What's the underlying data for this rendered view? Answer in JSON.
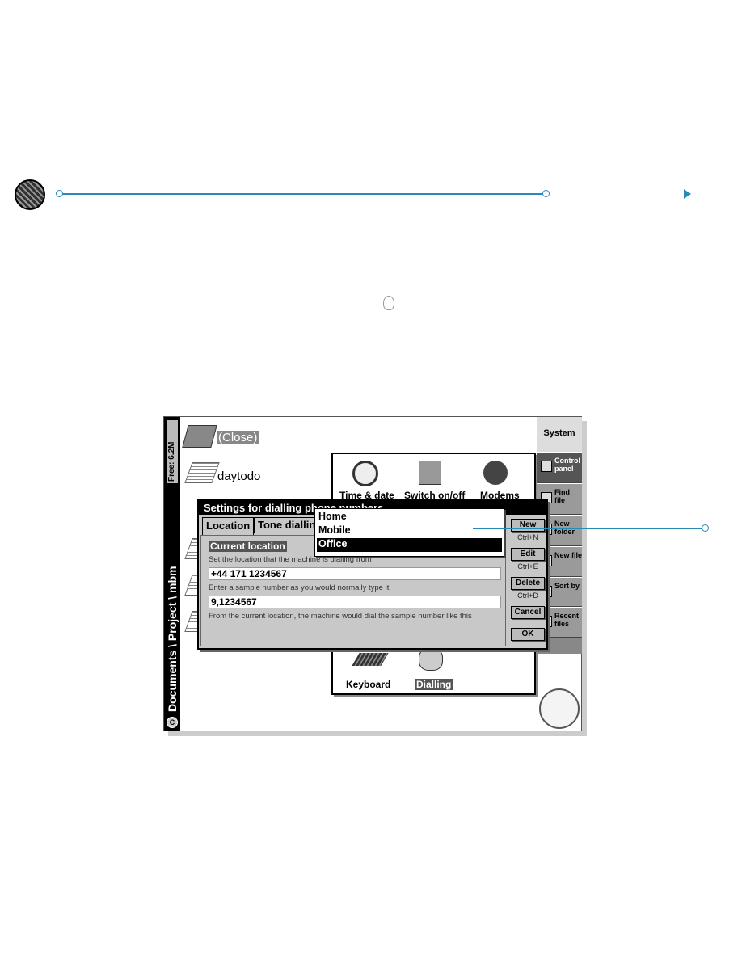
{
  "screen": {
    "free_space": "Free: 6.2M",
    "path": "Documents \\ Project \\ mbm",
    "drive": "C",
    "files": [
      {
        "label": "(Close)"
      },
      {
        "label": "daytodo"
      }
    ],
    "control_panel": {
      "items": [
        "Time & date",
        "Switch on/off",
        "Modems",
        "Keyboard",
        "Dialling"
      ]
    },
    "toolbar": {
      "title": "System",
      "buttons": [
        "Control panel",
        "Find file",
        "New folder",
        "New file",
        "Sort by",
        "Recent files"
      ]
    },
    "dialog": {
      "title": "Settings for dialling phone numbers",
      "tabs": [
        "Location",
        "Tone dialling"
      ],
      "section": "Current location",
      "label_location": "Set the location that the machine is dialling from",
      "location_value": "+44 171 1234567",
      "label_sample": "Enter a sample number as you would normally type it",
      "sample_value": "9,1234567",
      "label_result": "From the current location, the machine would dial the sample number like this",
      "buttons": {
        "new": "New",
        "new_sc": "Ctrl+N",
        "edit": "Edit",
        "edit_sc": "Ctrl+E",
        "delete": "Delete",
        "delete_sc": "Ctrl+D",
        "cancel": "Cancel",
        "ok": "OK"
      },
      "dropdown": {
        "options": [
          "Home",
          "Mobile",
          "Office"
        ],
        "selected": "Office"
      }
    }
  },
  "colors": {
    "accent": "#2a8ab5",
    "toolbar": "#9a9a9a",
    "dialog": "#c8c8c8"
  }
}
